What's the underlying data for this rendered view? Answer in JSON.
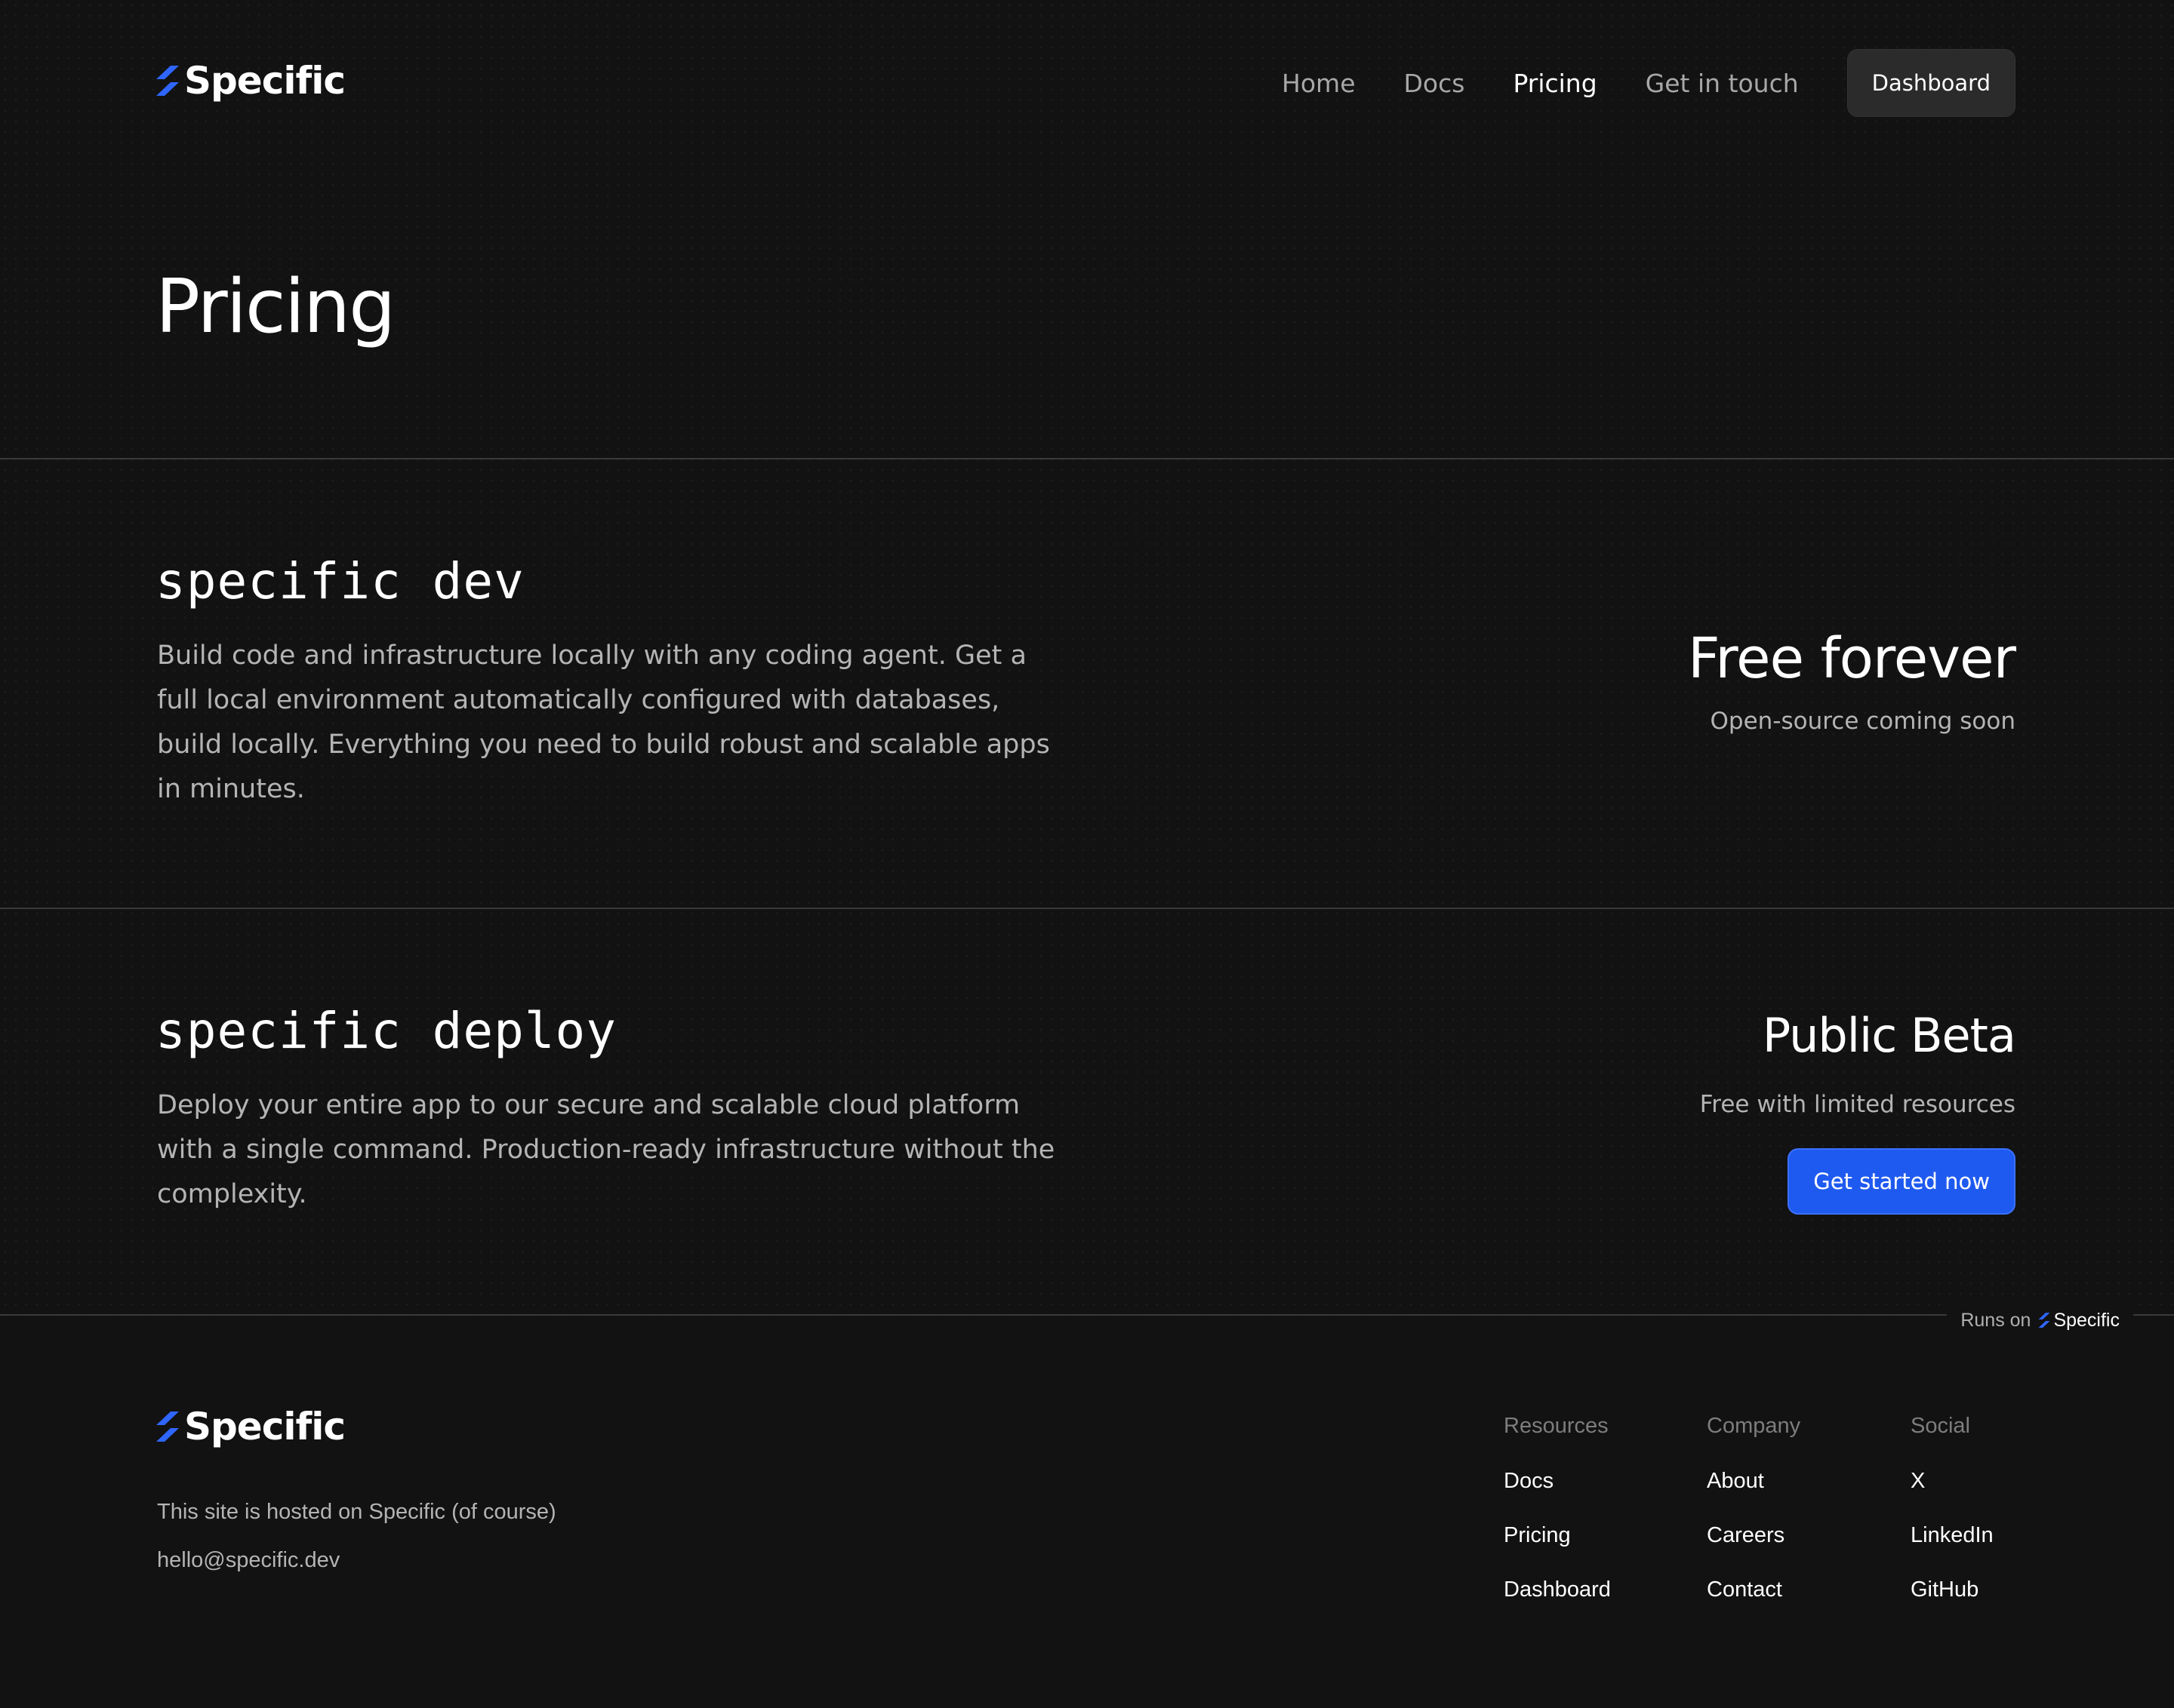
{
  "brand": {
    "name": "Specific",
    "accent_color": "#2f66ff",
    "background_color": "#121212"
  },
  "nav": {
    "items": [
      {
        "label": "Home",
        "active": false
      },
      {
        "label": "Docs",
        "active": false
      },
      {
        "label": "Pricing",
        "active": true
      },
      {
        "label": "Get in touch",
        "active": false
      }
    ],
    "dashboard_label": "Dashboard"
  },
  "page_title": "Pricing",
  "products": [
    {
      "name": "specific dev",
      "description": "Build code and infrastructure locally with any coding agent. Get a full local environment automatically configured with databases, build locally. Everything you need to build robust and scalable apps in minutes.",
      "price_title": "Free forever",
      "price_subtitle": "Open-source coming soon"
    },
    {
      "name": "specific deploy",
      "description": "Deploy your entire app to our secure and scalable cloud platform with a single command. Production-ready infrastructure without the complexity.",
      "price_title": "Public Beta",
      "price_subtitle": "Free with limited resources",
      "cta_label": "Get started now",
      "cta_color": "#1f5af0"
    }
  ],
  "runs_on": {
    "prefix": "Runs on",
    "brand": "Specific"
  },
  "footer": {
    "tagline": "This site is hosted on Specific (of course)",
    "email": "hello@specific.dev",
    "columns": [
      {
        "title": "Resources",
        "links": [
          "Docs",
          "Pricing",
          "Dashboard"
        ]
      },
      {
        "title": "Company",
        "links": [
          "About",
          "Careers",
          "Contact"
        ]
      },
      {
        "title": "Social",
        "links": [
          "X",
          "LinkedIn",
          "GitHub"
        ]
      }
    ]
  }
}
